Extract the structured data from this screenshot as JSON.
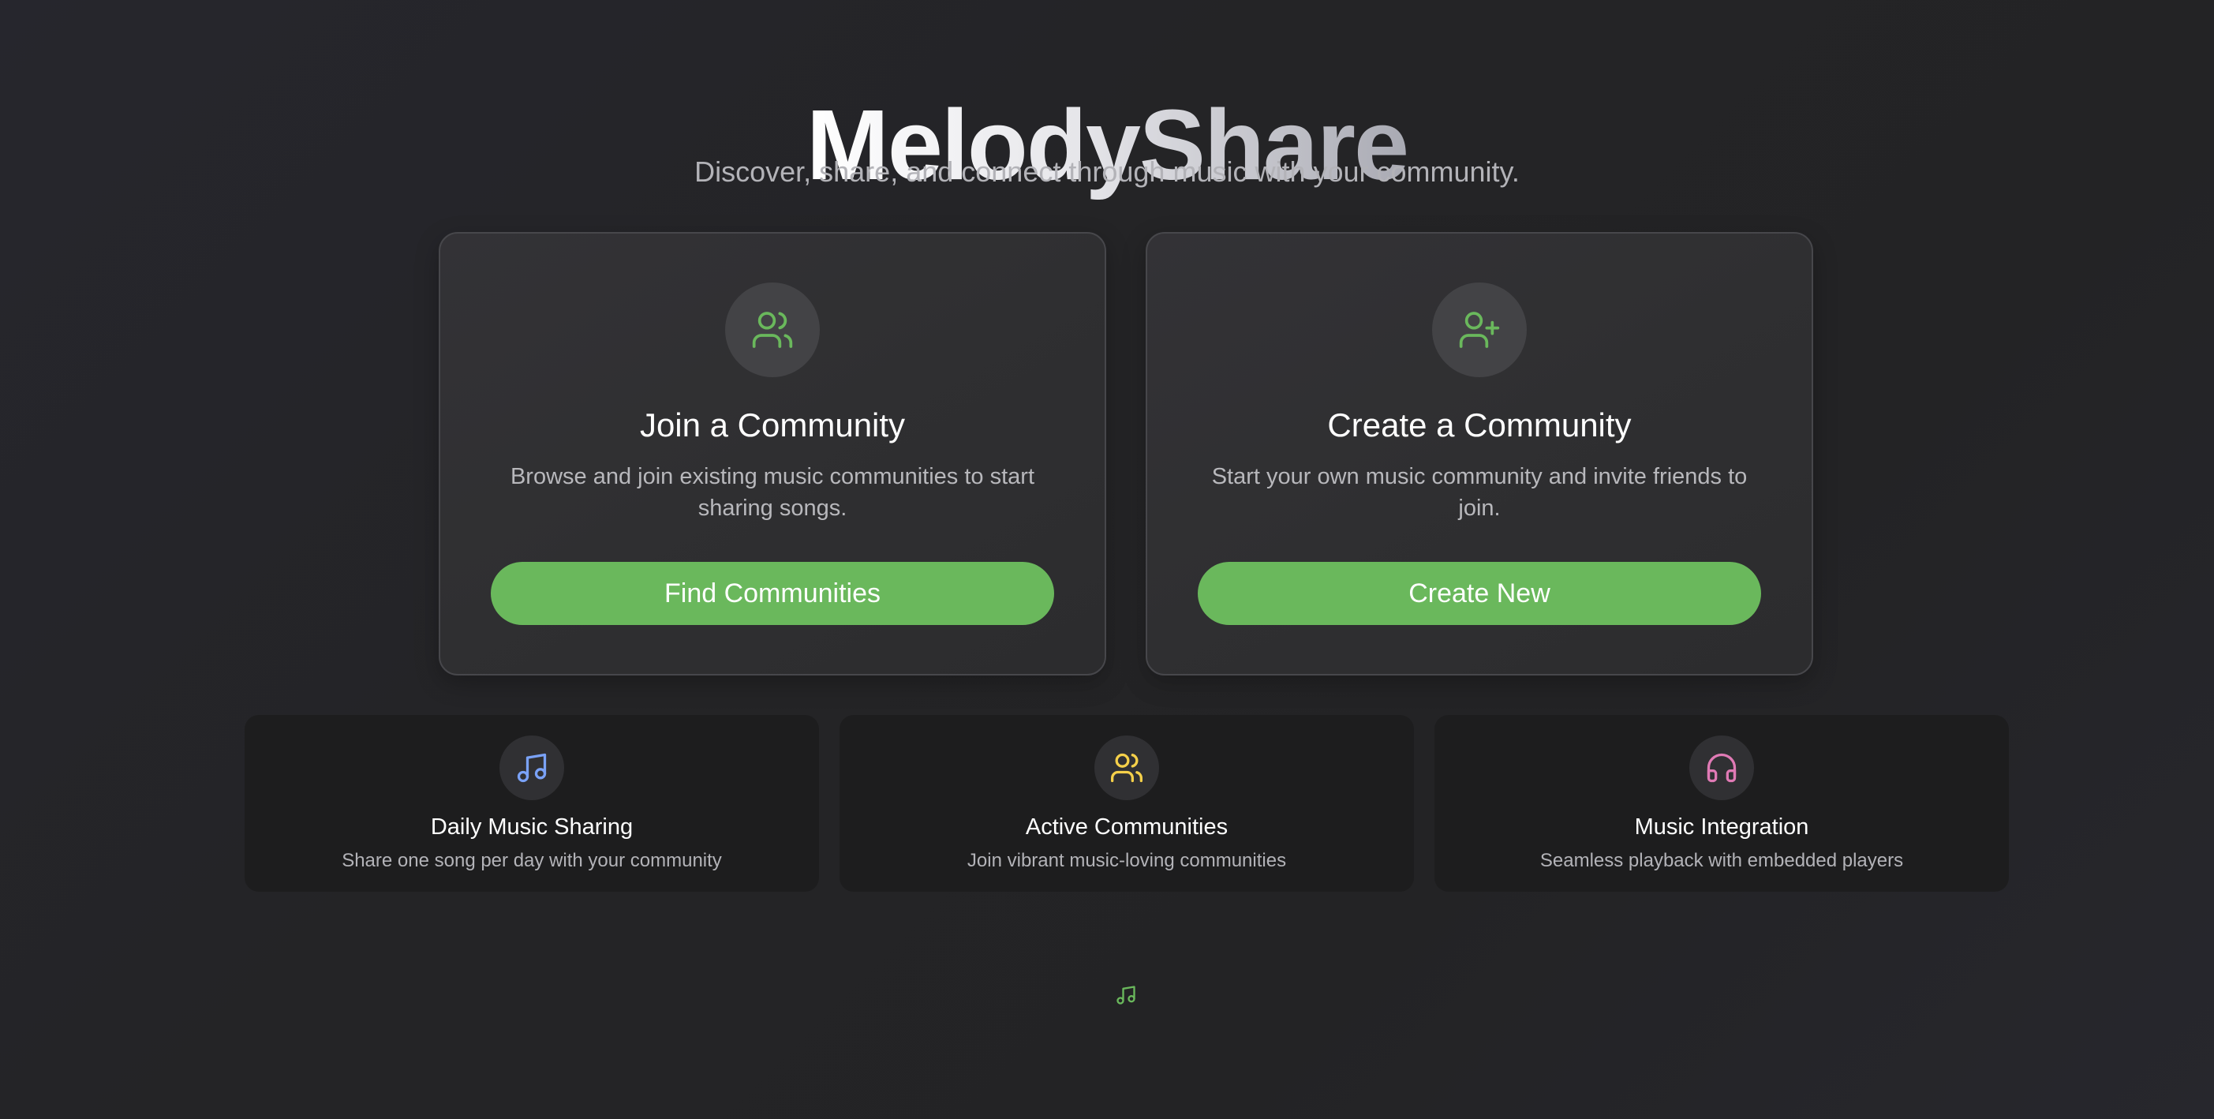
{
  "header": {
    "title": "MelodyShare",
    "subtitle": "Discover, share, and connect through music with your community."
  },
  "actions": [
    {
      "icon": "users-icon",
      "heading": "Join a Community",
      "description": "Browse and join existing music communities to start sharing songs.",
      "button_label": "Find Communities"
    },
    {
      "icon": "user-plus-icon",
      "heading": "Create a Community",
      "description": "Start your own music community and invite friends to join.",
      "button_label": "Create New"
    }
  ],
  "features": [
    {
      "icon": "music-note-icon",
      "title": "Daily Music Sharing",
      "description": "Share one song per day with your community"
    },
    {
      "icon": "users-icon",
      "title": "Active Communities",
      "description": "Join vibrant music-loving communities"
    },
    {
      "icon": "headphones-icon",
      "title": "Music Integration",
      "description": "Seamless playback with embedded players"
    }
  ],
  "footer": {
    "icon": "music-note-icon"
  },
  "colors": {
    "accent_green": "#6ab85c",
    "icon_blue": "#7aa2f7",
    "icon_yellow": "#f5d04a",
    "icon_pink": "#e07ab5",
    "background": "#242426"
  }
}
